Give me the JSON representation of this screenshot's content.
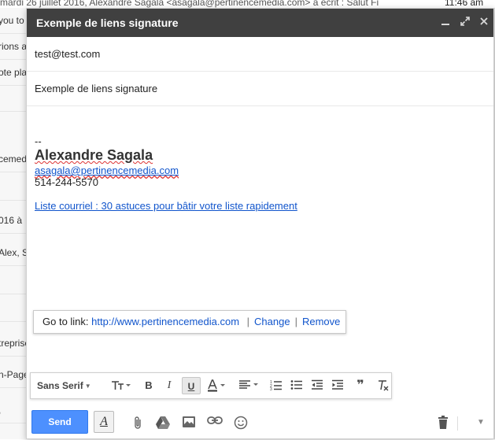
{
  "background": {
    "topline": "mardi 26 juillet 2016, Alexandre Sagala <asagala@pertinencemedia.com> a écrit : Salut Fi",
    "time": "11:46 am",
    "rows": [
      "you to",
      "rions a",
      "ote pla",
      "",
      "cemed",
      "",
      "016 à",
      "Alex, S",
      "",
      "",
      "treprise",
      "n-Page",
      ","
    ]
  },
  "compose": {
    "title": "Exemple de liens signature",
    "to": "test@test.com",
    "subject": "Exemple de liens signature",
    "signature": {
      "dash": "--",
      "name": "Alexandre Sagala",
      "email": "asagala@pertinencemedia.com",
      "phone": "514-244-5570",
      "link_text": "Liste courriel : 30 astuces pour bâtir votre liste rapidement"
    },
    "link_popup": {
      "prefix": "Go to link:",
      "url": "http://www.pertinencemedia.com",
      "sep": "|",
      "change": "Change",
      "remove": "Remove"
    }
  },
  "toolbar": {
    "font": "Sans Serif",
    "bold": "B",
    "italic": "I",
    "underline": "U",
    "color": "A",
    "quote": "❞"
  },
  "bottom": {
    "send": "Send",
    "format_glyph": "A"
  }
}
